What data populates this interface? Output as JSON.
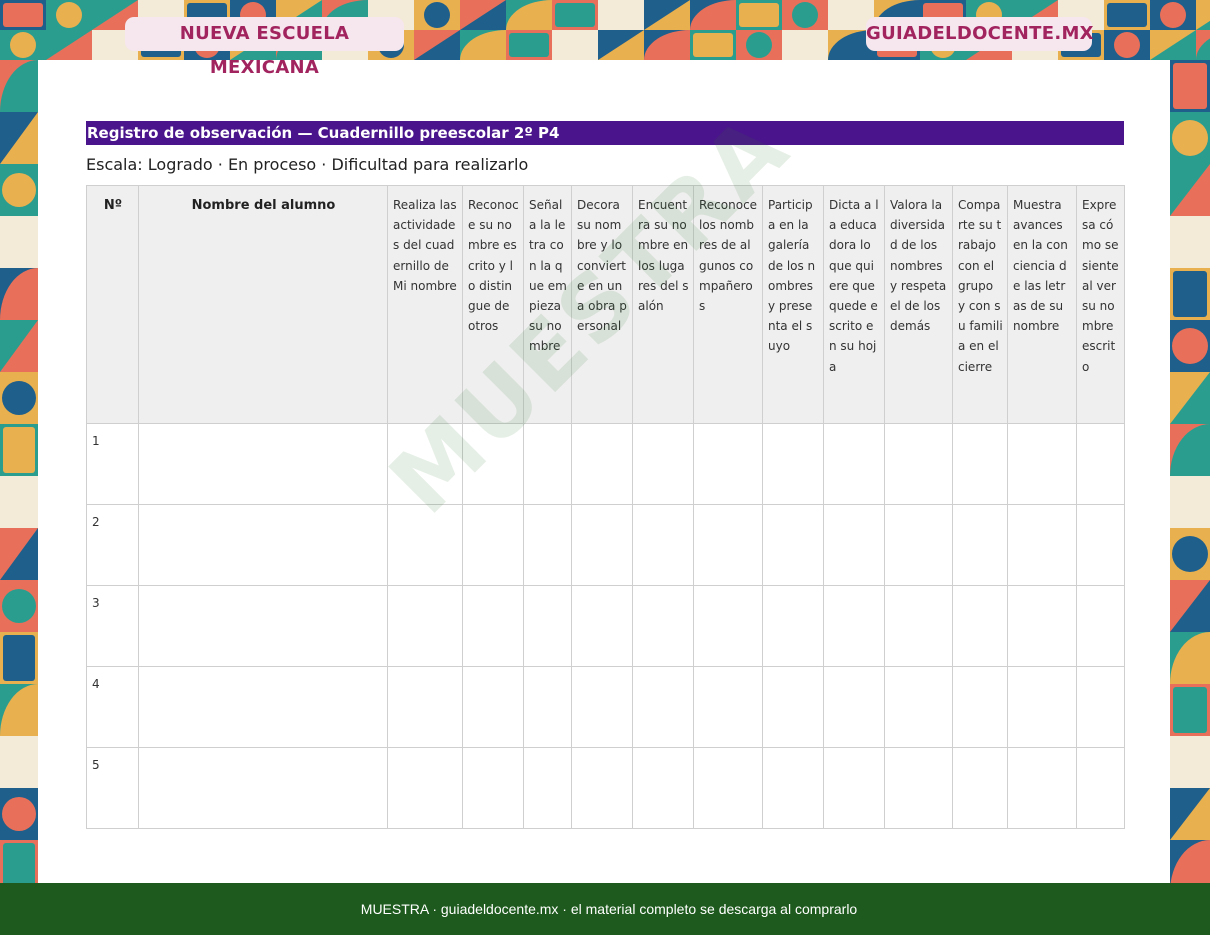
{
  "header": {
    "left_badge": "NUEVA ESCUELA MEXICANA",
    "right_badge": "GUIADELDOCENTE.MX"
  },
  "document": {
    "title": "Registro de observación — Cuadernillo preescolar 2º P4",
    "scale": "Escala: Logrado · En proceso · Dificultad para realizarlo"
  },
  "table": {
    "col_no": "Nº",
    "col_name": "Nombre del alumno",
    "criteria": [
      "Realiza las actividades del cuadernillo de Mi nombre",
      "Reconoce su nombre escrito y lo distingue de otros",
      "Señala la letra con la que empieza su nombre",
      "Decora su nombre y lo convierte en una obra personal",
      "Encuentra su nombre en los lugares del salón",
      "Reconoce los nombres de algunos compañeros",
      "Participa en la galería de los nombres y presenta el suyo",
      "Dicta a la educadora lo que quiere que quede escrito en su hoja",
      "Valora la diversidad de los nombres y respeta el de los demás",
      "Comparte su trabajo con el grupo y con su familia en el cierre",
      "Muestra avances en la conciencia de las letras de su nombre",
      "Expresa cómo se siente al ver su nombre escrito"
    ],
    "rows": [
      "1",
      "2",
      "3",
      "4",
      "5"
    ]
  },
  "watermark": "MUESTRA",
  "footer": {
    "text": "MUESTRA · guiadeldocente.mx · el material completo se descarga al comprarlo"
  },
  "colors": {
    "title_bar": "#4a148c",
    "footer_bg": "#1e5a1e",
    "badge_bg": "#f6e6ee",
    "badge_text": "#a2245f",
    "mosaic": [
      "#e8705a",
      "#2a9d8f",
      "#1f5f8b",
      "#e9b04f",
      "#f3ead8"
    ]
  }
}
